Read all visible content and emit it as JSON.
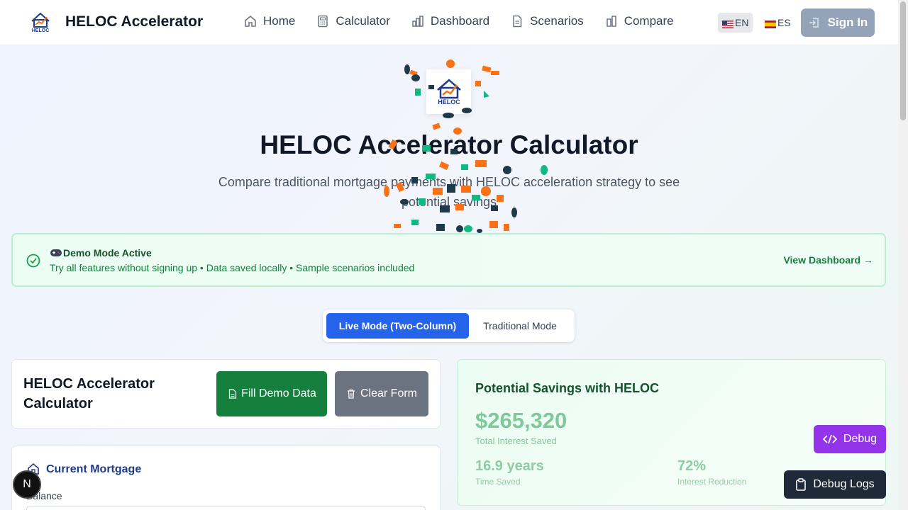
{
  "header": {
    "brand": "HELOC Accelerator",
    "logo_text": "HELOC Accelerator",
    "nav": [
      {
        "label": "Home",
        "icon": "home-icon"
      },
      {
        "label": "Calculator",
        "icon": "calculator-icon"
      },
      {
        "label": "Dashboard",
        "icon": "chart-bar-icon"
      },
      {
        "label": "Scenarios",
        "icon": "document-icon"
      },
      {
        "label": "Compare",
        "icon": "compare-icon"
      }
    ],
    "lang_en": "EN",
    "lang_es": "ES",
    "signin": "Sign In"
  },
  "hero": {
    "title": "HELOC Accelerator Calculator",
    "subtitle": "Compare traditional mortgage payments with HELOC acceleration strategy to see potential savings"
  },
  "demo": {
    "title": "Demo Mode Active",
    "description": "Try all features without signing up • Data saved locally • Sample scenarios included",
    "link": "View Dashboard →"
  },
  "mode_toggle": {
    "live": "Live Mode (Two-Column)",
    "traditional": "Traditional Mode"
  },
  "calculator": {
    "title": "HELOC Accelerator Calculator",
    "fill_demo": "Fill Demo Data",
    "clear_form": "Clear Form"
  },
  "mortgage": {
    "title": "Current Mortgage",
    "balance_label": "Balance"
  },
  "savings": {
    "title": "Potential Savings with HELOC",
    "amount": "$265,320",
    "amount_label": "Total Interest Saved",
    "time_saved": "16.9 years",
    "time_saved_label": "Time Saved",
    "interest_reduction": "72%",
    "interest_reduction_label": "Interest Reduction"
  },
  "floating": {
    "debug": "Debug",
    "debug_logs": "Debug Logs",
    "next_badge": "N"
  },
  "colors": {
    "primary": "#2563eb",
    "success": "#15803d",
    "debug": "#9333ea",
    "confetti_orange": "#f97316",
    "confetti_green": "#10b981",
    "confetti_dark": "#1e3a4a"
  }
}
